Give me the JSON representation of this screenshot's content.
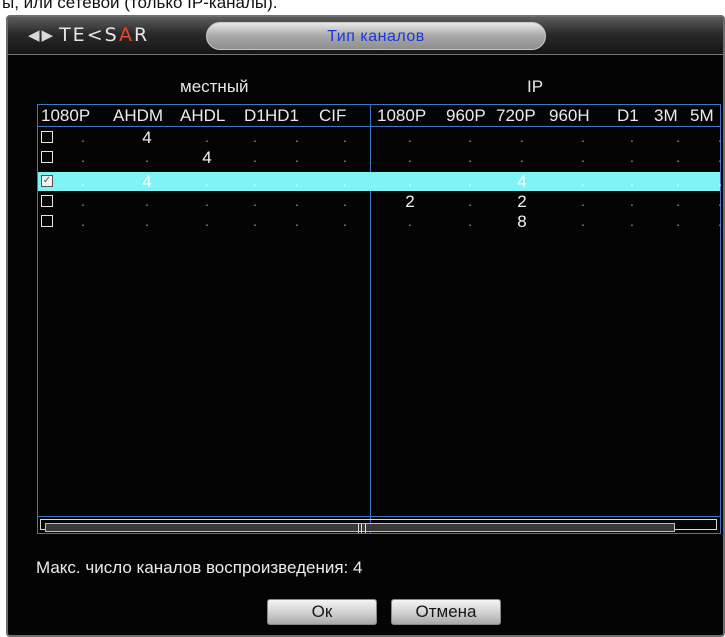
{
  "document": {
    "partial_text": "ы, или сетевой (только IP-каналы)."
  },
  "window": {
    "logo_text": "TE<SAR",
    "title": "Тип каналов"
  },
  "groups": {
    "local": "местный",
    "ip": "IP"
  },
  "columns": {
    "local": [
      "1080P",
      "AHDM",
      "AHDL",
      "D1",
      "HD1",
      "CIF"
    ],
    "ip": [
      "1080P",
      "960P",
      "720P",
      "960H",
      "D1",
      "3M",
      "5M"
    ]
  },
  "rows": [
    {
      "checked": false,
      "selected": false,
      "local": [
        "",
        "4",
        "",
        "",
        "",
        ""
      ],
      "ip": [
        "",
        "",
        "",
        "",
        "",
        "",
        ""
      ]
    },
    {
      "checked": false,
      "selected": false,
      "local": [
        "",
        "",
        "4",
        "",
        "",
        ""
      ],
      "ip": [
        "",
        "",
        "",
        "",
        "",
        "",
        ""
      ]
    },
    {
      "checked": true,
      "selected": true,
      "local": [
        "",
        "4",
        "",
        "",
        "",
        ""
      ],
      "ip": [
        "",
        "",
        "4",
        "",
        "",
        "",
        ""
      ]
    },
    {
      "checked": false,
      "selected": false,
      "local": [
        "",
        "",
        "",
        "",
        "",
        ""
      ],
      "ip": [
        "2",
        "",
        "2",
        "",
        "",
        "",
        ""
      ]
    },
    {
      "checked": false,
      "selected": false,
      "local": [
        "",
        "",
        "",
        "",
        "",
        ""
      ],
      "ip": [
        "",
        "",
        "8",
        "",
        "",
        "",
        ""
      ]
    }
  ],
  "empty_marker": ".",
  "check_mark": "✓",
  "footer": {
    "max_channels": "Макс. число каналов воспроизведения: 4"
  },
  "buttons": {
    "ok": "Ок",
    "cancel": "Отмена"
  },
  "colors": {
    "highlight": "#7ff4f4",
    "border": "#3e78c5",
    "title_text": "#1a37d8"
  }
}
